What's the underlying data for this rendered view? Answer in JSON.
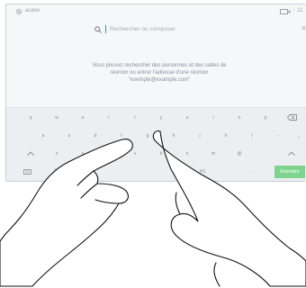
{
  "statusbar": {
    "brand": "acano",
    "time": "11:"
  },
  "search": {
    "placeholder": "Rechercher ou composer"
  },
  "info": {
    "line1": "Vous pouvez rechercher des personnes et des salles de",
    "line2": "réunion ou entrer l'adresse d'une réunion",
    "line3": "\"exemple@example.com\""
  },
  "keyboard": {
    "row1": [
      "q",
      "w",
      "e",
      "r",
      "t",
      "y",
      "u",
      "i",
      "o",
      "p"
    ],
    "row2": [
      "a",
      "s",
      "d",
      "f",
      "g",
      "h",
      "j",
      "k",
      "l",
      "-",
      "_"
    ],
    "row3": [
      "z",
      "x",
      "c",
      "v",
      "b",
      "n",
      "m",
      "@"
    ],
    "row4": {
      "numbers": "?123",
      "symbols": "!#1",
      "dot": "."
    },
    "enter_label": "Rejoindre"
  },
  "colors": {
    "accent": "#7ed48d",
    "caret": "#3a8fd8"
  }
}
